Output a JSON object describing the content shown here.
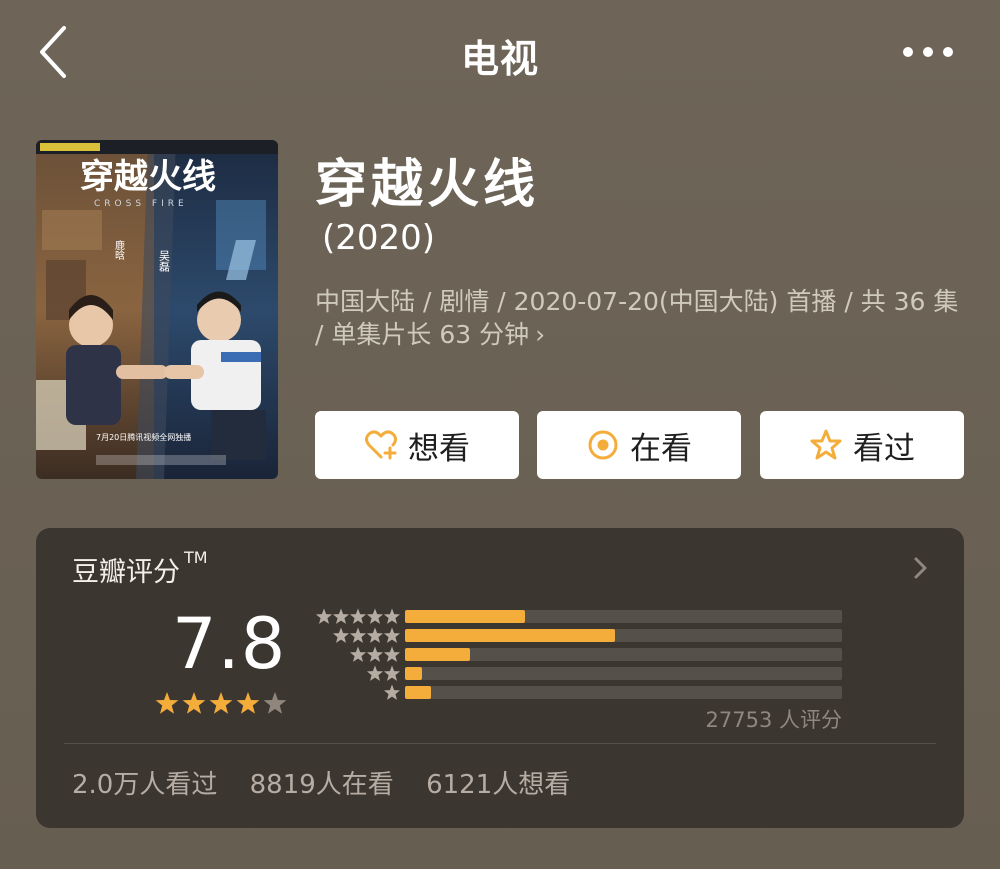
{
  "nav": {
    "title": "电视",
    "back_icon": "chevron-left-icon",
    "more_icon": "more-dots-icon"
  },
  "movie": {
    "title": "穿越火线",
    "year": "(2020)",
    "meta": "中国大陆 / 剧情 / 2020-07-20(中国大陆) 首播 / 共 36 集 / 单集片长 63 分钟",
    "meta_chevron": "›",
    "poster": {
      "title_text": "穿越火线",
      "subtitle_text": "CROSS FIRE",
      "actor_right": "吴磊",
      "actor_right_role": "饰 吴磊",
      "actor_left": "鹿晗",
      "actor_left_role": "饰 肖枫",
      "air_info": "7月20日腾讯视频全网独播"
    }
  },
  "actions": [
    {
      "label": "想看",
      "icon": "heart-plus-icon"
    },
    {
      "label": "在看",
      "icon": "target-circle-icon"
    },
    {
      "label": "看过",
      "icon": "star-outline-icon"
    }
  ],
  "rating": {
    "title": "豆瓣评分",
    "tm": "TM",
    "score": "7.8",
    "score_stars": 4,
    "score_stars_max": 5,
    "distribution": [
      {
        "stars": 5,
        "fraction": 0.275
      },
      {
        "stars": 4,
        "fraction": 0.48
      },
      {
        "stars": 3,
        "fraction": 0.148
      },
      {
        "stars": 2,
        "fraction": 0.04
      },
      {
        "stars": 1,
        "fraction": 0.06
      }
    ],
    "count": "27753 人评分",
    "accent_color": "#f4ad3a"
  },
  "stats": {
    "watched": "2.0万人看过",
    "watching": "8819人在看",
    "wish": "6121人想看"
  }
}
